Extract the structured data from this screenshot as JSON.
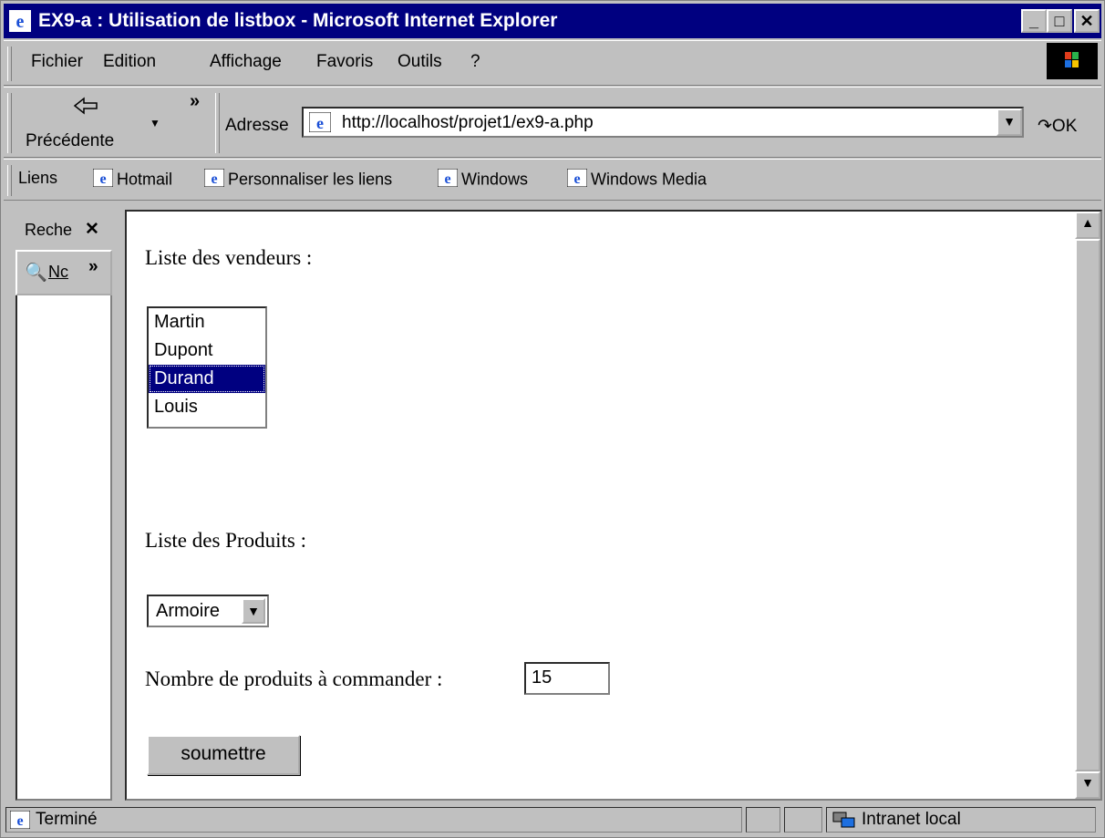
{
  "window": {
    "title": "EX9-a : Utilisation de listbox - Microsoft Internet Explorer",
    "minimize": "_",
    "maximize": "□",
    "close": "✕"
  },
  "menu": [
    {
      "label": "Fichier"
    },
    {
      "label": "Edition"
    },
    {
      "label": "Affichage"
    },
    {
      "label": "Favoris"
    },
    {
      "label": "Outils"
    },
    {
      "label": "?"
    }
  ],
  "toolbar": {
    "back_label": "Précédente",
    "chevron": "»",
    "address_label": "Adresse",
    "url": "http://localhost/projet1/ex9-a.php",
    "go_label": "OK"
  },
  "links_bar": {
    "label": "Liens",
    "items": [
      "Hotmail",
      "Personnaliser les liens",
      "Windows",
      "Windows Media"
    ]
  },
  "search_pane": {
    "title": "Reche",
    "close": "✕",
    "new_label": "Nc",
    "chevron": "»"
  },
  "page": {
    "vendors_label": "Liste des vendeurs :",
    "vendors": [
      "Martin",
      "Dupont",
      "Durand",
      "Louis"
    ],
    "selected_vendor_index": 2,
    "products_label": "Liste des Produits :",
    "product_selected": "Armoire",
    "quantity_label": "Nombre de produits à commander :",
    "quantity_value": "15",
    "submit_label": "soumettre"
  },
  "statusbar": {
    "text": "Terminé",
    "zone": "Intranet local"
  },
  "colors": {
    "titlebar": "#000080",
    "selection": "#000080",
    "face": "#c0c0c0"
  }
}
